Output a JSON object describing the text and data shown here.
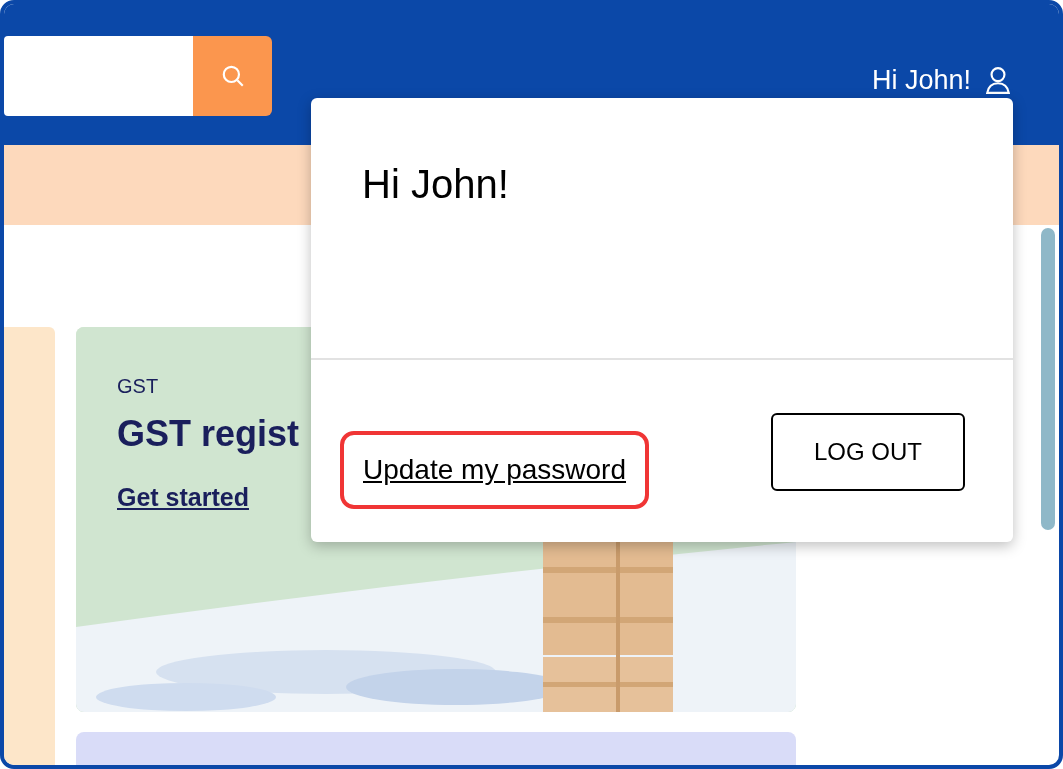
{
  "header": {
    "greeting": "Hi John!"
  },
  "cards": [
    {
      "kind": "picture-card",
      "category": "GST",
      "title": "GST regist",
      "link": "Get started"
    }
  ],
  "user_menu": {
    "title": "Hi John!",
    "link": "Update my password",
    "link_highlighted": true,
    "button": "LOG OUT"
  }
}
